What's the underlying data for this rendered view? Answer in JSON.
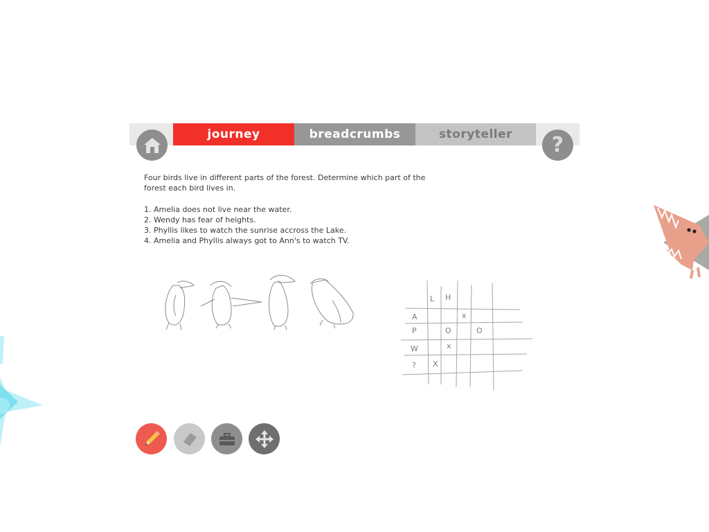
{
  "nav": {
    "home_icon": "home-icon",
    "help_icon": "question-mark-icon",
    "help_glyph": "?",
    "tabs": [
      {
        "label": "journey",
        "active": true,
        "color": "#f1302a"
      },
      {
        "label": "breadcrumbs",
        "active": false,
        "color": "#979797"
      },
      {
        "label": "storyteller",
        "active": false,
        "color": "#c3c3c3"
      }
    ]
  },
  "puzzle": {
    "intro": "Four birds live in different parts of the forest. Determine which part of the forest each bird lives in.",
    "clues": [
      "1. Amelia does not live near the water.",
      "2. Wendy has fear of heights.",
      "3. Phyllis likes to watch the sunrise accross the Lake.",
      "4. Amelia and Phyllis always got to Ann's to watch TV."
    ]
  },
  "sketch": {
    "grid_cols": [
      "L",
      "H"
    ],
    "grid_rows": [
      "A",
      "P",
      "W",
      "?"
    ],
    "marks": [
      "x",
      "O",
      "O",
      "x",
      "X"
    ]
  },
  "tools": [
    {
      "icon": "pencil-icon",
      "color": "#ef5a50"
    },
    {
      "icon": "eraser-icon",
      "color": "#c9c9c9"
    },
    {
      "icon": "toolbox-icon",
      "color": "#8e8e8e"
    },
    {
      "icon": "move-arrows-icon",
      "color": "#6f6f6f"
    }
  ]
}
